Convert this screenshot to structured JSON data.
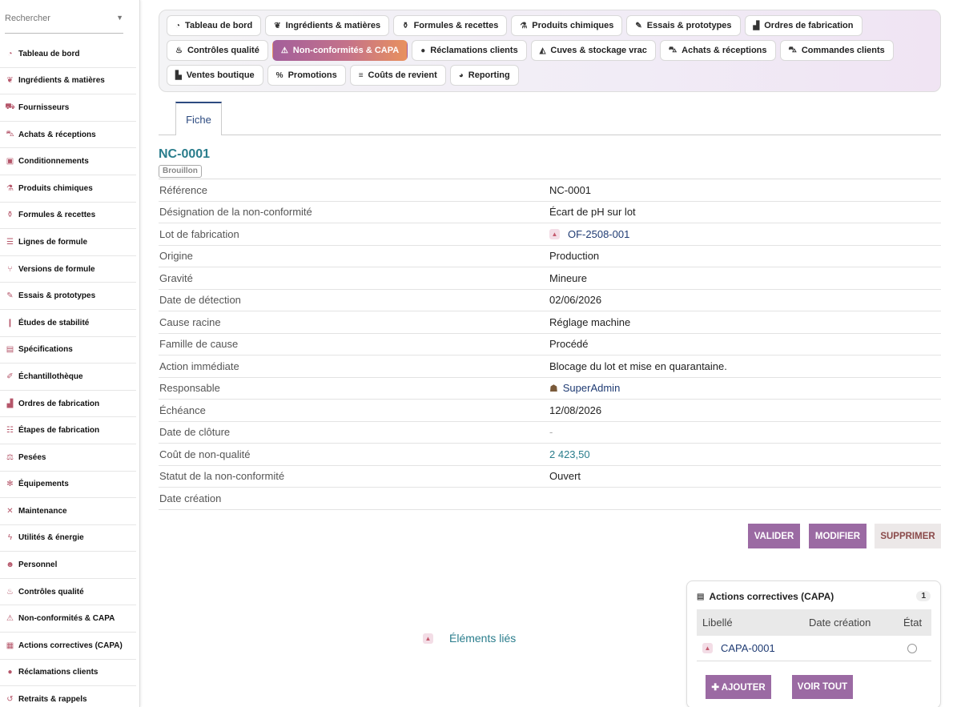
{
  "sidebar": {
    "search_placeholder": "Rechercher",
    "items": [
      {
        "label": "Tableau de bord",
        "icon": "dashboard-icon"
      },
      {
        "label": "Ingrédients & matières",
        "icon": "leaf-icon"
      },
      {
        "label": "Fournisseurs",
        "icon": "truck-icon"
      },
      {
        "label": "Achats & réceptions",
        "icon": "cart-icon"
      },
      {
        "label": "Conditionnements",
        "icon": "box-icon"
      },
      {
        "label": "Produits chimiques",
        "icon": "chemical-icon"
      },
      {
        "label": "Formules & recettes",
        "icon": "flask-icon"
      },
      {
        "label": "Lignes de formule",
        "icon": "list-icon"
      },
      {
        "label": "Versions de formule",
        "icon": "branch-icon"
      },
      {
        "label": "Essais & prototypes",
        "icon": "eyedropper-icon"
      },
      {
        "label": "Études de stabilité",
        "icon": "vial-icon"
      },
      {
        "label": "Spécifications",
        "icon": "clipboard-icon"
      },
      {
        "label": "Échantillothèque",
        "icon": "sample-icon"
      },
      {
        "label": "Ordres de fabrication",
        "icon": "industry-icon"
      },
      {
        "label": "Étapes de fabrication",
        "icon": "steps-icon"
      },
      {
        "label": "Pesées",
        "icon": "scale-icon"
      },
      {
        "label": "Équipements",
        "icon": "cogs-icon"
      },
      {
        "label": "Maintenance",
        "icon": "tools-icon"
      },
      {
        "label": "Utilités & énergie",
        "icon": "bolt-icon"
      },
      {
        "label": "Personnel",
        "icon": "users-icon"
      },
      {
        "label": "Contrôles qualité",
        "icon": "microscope-icon"
      },
      {
        "label": "Non-conformités & CAPA",
        "icon": "warning-icon"
      },
      {
        "label": "Actions correctives (CAPA)",
        "icon": "clipboard-check-icon"
      },
      {
        "label": "Réclamations clients",
        "icon": "comment-icon"
      },
      {
        "label": "Retraits & rappels",
        "icon": "undo-icon"
      }
    ]
  },
  "topmenu": {
    "rows": [
      [
        {
          "label": "Tableau de bord",
          "icon": "dashboard-icon"
        },
        {
          "label": "Ingrédients & matières",
          "icon": "leaf-icon"
        },
        {
          "label": "Formules & recettes",
          "icon": "flask-icon"
        },
        {
          "label": "Produits chimiques",
          "icon": "chemical-icon"
        },
        {
          "label": "Essais & prototypes",
          "icon": "eyedropper-icon"
        },
        {
          "label": "Ordres de fabrication",
          "icon": "industry-icon"
        }
      ],
      [
        {
          "label": "Contrôles qualité",
          "icon": "microscope-icon"
        },
        {
          "label": "Non-conformités & CAPA",
          "icon": "warning-icon",
          "active": true
        },
        {
          "label": "Réclamations clients",
          "icon": "comment-icon"
        },
        {
          "label": "Cuves & stockage vrac",
          "icon": "fill-icon"
        },
        {
          "label": "Achats & réceptions",
          "icon": "cart-icon"
        },
        {
          "label": "Commandes clients",
          "icon": "shopping-cart-icon"
        }
      ],
      [
        {
          "label": "Ventes boutique",
          "icon": "cash-register-icon"
        },
        {
          "label": "Promotions",
          "icon": "percent-icon"
        },
        {
          "label": "Coûts de revient",
          "icon": "coins-icon"
        },
        {
          "label": "Reporting",
          "icon": "chart-pie-icon"
        }
      ]
    ]
  },
  "tabs": {
    "active": "Fiche"
  },
  "record": {
    "title": "NC-0001",
    "status": "Brouillon",
    "fields": [
      {
        "label": "Référence",
        "value": "NC-0001"
      },
      {
        "label": "Désignation de la non-conformité",
        "value": "Écart de pH sur lot"
      },
      {
        "label": "Lot de fabrication",
        "value": "OF-2508-001",
        "kind": "link",
        "icon": "industry-icon"
      },
      {
        "label": "Origine",
        "value": "Production"
      },
      {
        "label": "Gravité",
        "value": "Mineure"
      },
      {
        "label": "Date de détection",
        "value": "02/06/2026"
      },
      {
        "label": "Cause racine",
        "value": "Réglage machine"
      },
      {
        "label": "Famille de cause",
        "value": "Procédé"
      },
      {
        "label": "Action immédiate",
        "value": "Blocage du lot et mise en quarantaine."
      },
      {
        "label": "Responsable",
        "value": "SuperAdmin",
        "kind": "user",
        "icon": "user-icon"
      },
      {
        "label": "Échéance",
        "value": "12/08/2026"
      },
      {
        "label": "Date de clôture",
        "value": "-",
        "kind": "muted"
      },
      {
        "label": "Coût de non-qualité",
        "value": "2 423,50",
        "kind": "amount"
      },
      {
        "label": "Statut de la non-conformité",
        "value": "Ouvert"
      },
      {
        "label": "Date création",
        "value": ""
      }
    ]
  },
  "actions": {
    "validate": "VALIDER",
    "edit": "MODIFIER",
    "delete": "SUPPRIMER"
  },
  "linked": {
    "label": "Éléments liés"
  },
  "capa": {
    "title": "Actions correctives (CAPA)",
    "count": "1",
    "columns": [
      "Libellé",
      "Date création",
      "État"
    ],
    "rows": [
      {
        "label": "CAPA-0001",
        "date": "",
        "state": ""
      }
    ],
    "add_label": "AJOUTER",
    "view_all_label": "VOIR TOUT"
  },
  "colors": {
    "accent": "#9b6aa3",
    "link": "#1f3b73",
    "teal": "#2a7d8c",
    "warning": "#e8915e"
  }
}
